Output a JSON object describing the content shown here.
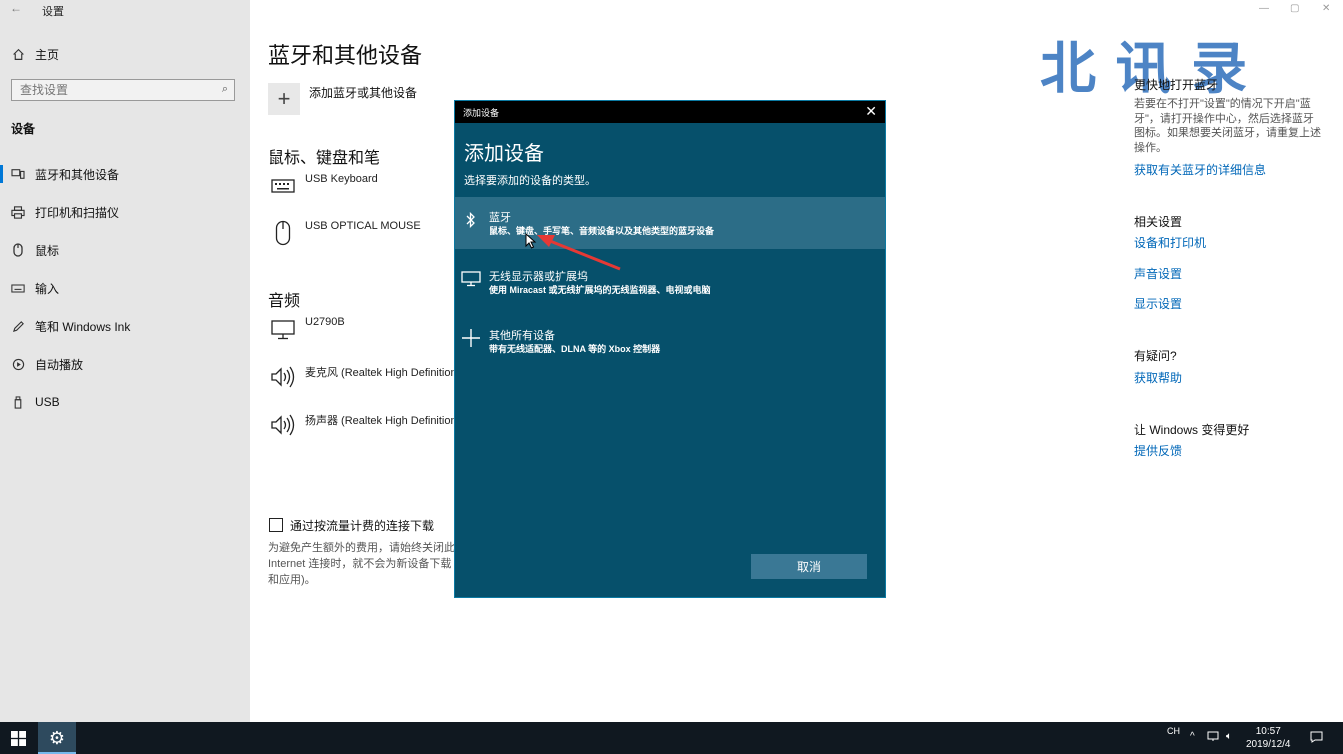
{
  "window": {
    "title": "设置",
    "back_icon": "back-arrow-icon",
    "minimize": "—",
    "restore": "▢",
    "close": "✕"
  },
  "sidebar": {
    "home_label": "主页",
    "search_placeholder": "查找设置",
    "section_label": "设备",
    "items": [
      {
        "label": "蓝牙和其他设备",
        "icon": "bluetooth-devices-icon"
      },
      {
        "label": "打印机和扫描仪",
        "icon": "printer-icon"
      },
      {
        "label": "鼠标",
        "icon": "mouse-icon"
      },
      {
        "label": "输入",
        "icon": "keyboard-icon"
      },
      {
        "label": "笔和 Windows Ink",
        "icon": "pen-icon"
      },
      {
        "label": "自动播放",
        "icon": "autoplay-icon"
      },
      {
        "label": "USB",
        "icon": "usb-icon"
      }
    ]
  },
  "main": {
    "title": "蓝牙和其他设备",
    "add_device_label": "添加蓝牙或其他设备",
    "mouse_section_title": "鼠标、键盘和笔",
    "mouse_devices": [
      {
        "label": "USB Keyboard"
      },
      {
        "label": "USB OPTICAL MOUSE"
      }
    ],
    "audio_section_title": "音频",
    "audio_devices": [
      {
        "label": "U2790B"
      },
      {
        "label": "麦克风 (Realtek High Definition"
      },
      {
        "label": "扬声器 (Realtek High Definition"
      }
    ],
    "metered_checkbox_label": "通过按流量计费的连接下载",
    "metered_checked": false,
    "metered_note": "为避免产生额外的费用，请始终关闭此 Internet 连接时，就不会为新设备下载 和应用)。"
  },
  "right_panel": {
    "watermark": "北 讯 录",
    "quick_title": "更快地打开蓝牙",
    "quick_text": "若要在不打开\"设置\"的情况下开启\"蓝牙\"，请打开操作中心，然后选择蓝牙图标。如果想要关闭蓝牙，请重复上述操作。",
    "quick_link": "获取有关蓝牙的详细信息",
    "related_title": "相关设置",
    "related_links": [
      "设备和打印机",
      "声音设置",
      "显示设置"
    ],
    "help_title": "有疑问?",
    "help_link": "获取帮助",
    "feedback_title": "让 Windows 变得更好",
    "feedback_link": "提供反馈"
  },
  "dialog": {
    "title": "添加设备",
    "close": "✕",
    "heading": "添加设备",
    "subheading": "选择要添加的设备的类型。",
    "options": [
      {
        "title": "蓝牙",
        "desc": "鼠标、键盘、手写笔、音频设备以及其他类型的蓝牙设备",
        "icon": "bluetooth-icon",
        "selected": true
      },
      {
        "title": "无线显示器或扩展坞",
        "desc": "使用 Miracast 或无线扩展坞的无线监视器、电视或电脑",
        "icon": "monitor-icon",
        "selected": false
      },
      {
        "title": "其他所有设备",
        "desc": "带有无线适配器、DLNA 等的 Xbox 控制器",
        "icon": "plus-icon",
        "selected": false
      }
    ],
    "cancel_label": "取消"
  },
  "taskbar": {
    "ime": "CH",
    "time": "10:57",
    "date": "2019/12/4"
  },
  "colors": {
    "accent": "#0078d7",
    "link": "#0067b8",
    "dialog_bg": "#06506b",
    "dialog_selected": "#2c6d87",
    "taskbar": "#101820"
  }
}
